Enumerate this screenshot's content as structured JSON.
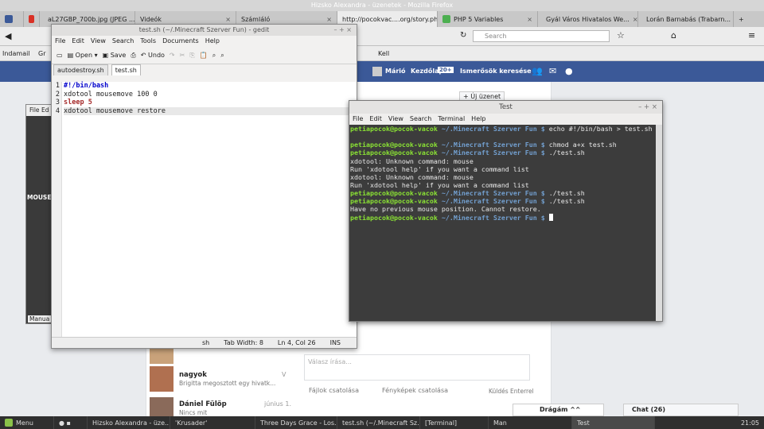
{
  "firefox": {
    "title": "Hizsko Alexandra - üzenetek - Mozilla Firefox",
    "tabs": [
      {
        "label": "aL27GBP_700b.jpg (JPEG ..."
      },
      {
        "label": "Videók"
      },
      {
        "label": "Számláló"
      },
      {
        "label": "http://pocokvac....org/story.php"
      },
      {
        "label": "PHP 5 Variables"
      },
      {
        "label": "Gyál Város Hivatalos We..."
      },
      {
        "label": "Lorán Barnabás (Trabarn..."
      }
    ],
    "search_placeholder": "Search",
    "bookmarks": [
      {
        "label": "Indamail"
      },
      {
        "label": "Gr"
      },
      {
        "label": "Kell"
      }
    ]
  },
  "facebook": {
    "user": "Márió",
    "home": "Kezdőlap",
    "home_count": "20+",
    "find_friends": "Ismerősök keresése",
    "new_message": "+ Új üzenet",
    "conversations": [
      {
        "name": "nagyok",
        "preview": "Brigitta megosztott egy hivatk...",
        "time": "V"
      },
      {
        "name": "Dániel Fülöp",
        "preview": "Nincs mit",
        "time": "június 1."
      }
    ],
    "reply_placeholder": "Válasz írása...",
    "attach_files": "Fájlok csatolása",
    "attach_photos": "Fényképek csatolása",
    "send_on_enter": "Küldés Enterrel",
    "friend_tab": "Drágám ^^",
    "chat": "Chat (26)"
  },
  "gedit": {
    "title": "test.sh (~/.Minecraft Szerver Fun) - gedit",
    "menu": [
      "File",
      "Edit",
      "View",
      "Search",
      "Tools",
      "Documents",
      "Help"
    ],
    "toolbar": {
      "open": "Open",
      "save": "Save",
      "undo": "Undo"
    },
    "tabs": [
      {
        "label": "autodestroy.sh"
      },
      {
        "label": "test.sh"
      }
    ],
    "lines": [
      {
        "num": "1",
        "text": "#!/bin/bash"
      },
      {
        "num": "2",
        "text": "xdotool mousemove 100 0"
      },
      {
        "num": "3",
        "text": "sleep 5"
      },
      {
        "num": "4",
        "text": "xdotool mousemove restore"
      }
    ],
    "status": {
      "lang": "sh",
      "tab_width": "Tab Width: 8",
      "position": "Ln 4, Col 26",
      "mode": "INS"
    }
  },
  "oldwin": {
    "menu_file": "File",
    "menu_edit": "Ed",
    "text": "MOUSE",
    "tab": "Manua"
  },
  "terminal": {
    "title": "Test",
    "menu": [
      "File",
      "Edit",
      "View",
      "Search",
      "Terminal",
      "Help"
    ],
    "user": "petiapocok@pocok-vacok",
    "dir": "~/.Minecraft Szerver Fun $",
    "lines": [
      {
        "type": "prompt",
        "cmd": "echo #!/bin/bash > test.sh"
      },
      {
        "type": "blank",
        "text": ""
      },
      {
        "type": "prompt",
        "cmd": "chmod a+x test.sh"
      },
      {
        "type": "prompt",
        "cmd": "./test.sh"
      },
      {
        "type": "out",
        "text": "xdotool: Unknown command: mouse"
      },
      {
        "type": "out",
        "text": "Run 'xdotool help' if you want a command list"
      },
      {
        "type": "out",
        "text": "xdotool: Unknown command: mouse"
      },
      {
        "type": "out",
        "text": "Run 'xdotool help' if you want a command list"
      },
      {
        "type": "prompt",
        "cmd": "./test.sh"
      },
      {
        "type": "prompt",
        "cmd": "./test.sh"
      },
      {
        "type": "out",
        "text": "Have no previous mouse position. Cannot restore."
      },
      {
        "type": "cursor",
        "cmd": ""
      }
    ]
  },
  "taskbar": {
    "menu": "Menu",
    "tasks": [
      {
        "label": "Hizsko Alexandra - üze..."
      },
      {
        "label": "'Krusader'"
      },
      {
        "label": "Three Days Grace - Los..."
      },
      {
        "label": "test.sh (~/.Minecraft Sz..."
      },
      {
        "label": "[Terminal]"
      },
      {
        "label": "Man"
      },
      {
        "label": "Test"
      }
    ],
    "clock": "21:05"
  }
}
